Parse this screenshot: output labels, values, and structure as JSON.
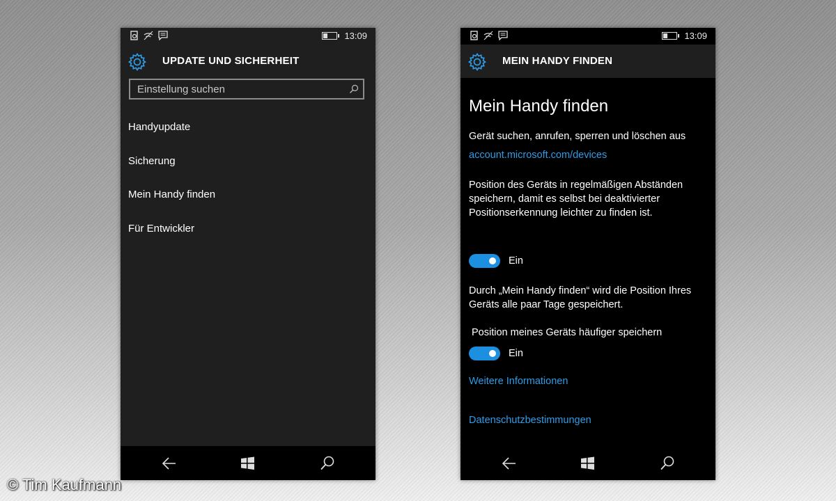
{
  "left_screen": {
    "status_time": "13:09",
    "header_title": "UPDATE UND SICHERHEIT",
    "search_placeholder": "Einstellung suchen",
    "menu_items": [
      "Handyupdate",
      "Sicherung",
      "Mein Handy finden",
      "Für Entwickler"
    ]
  },
  "right_screen": {
    "status_time": "13:09",
    "header_title": "MEIN HANDY FINDEN",
    "page_title": "Mein Handy finden",
    "description_1": "Gerät suchen, anrufen, sperren und löschen aus",
    "link_devices": "account.microsoft.com/devices",
    "description_2": "Position des Geräts in regelmäßigen Abständen speichern, damit es selbst bei deaktivierter Positionserkennung leichter zu finden ist.",
    "toggle_1_label": "Ein",
    "toggle_1_on": true,
    "description_3": "Durch „Mein Handy finden“ wird die Position Ihres Geräts alle paar Tage gespeichert.",
    "option_label": "Position meines Geräts häufiger speichern",
    "toggle_2_label": "Ein",
    "toggle_2_on": true,
    "link_more": "Weitere Informationen",
    "link_privacy": "Datenschutzbestimmungen"
  },
  "icons": [
    "battery-saver-icon",
    "wifi-icon",
    "message-icon",
    "battery-icon",
    "gear-icon",
    "search-icon",
    "back-icon",
    "windows-icon"
  ],
  "colors": {
    "accent": "#1d8fe0",
    "link": "#2f9ce6",
    "panel": "#1f1f1f"
  },
  "watermark": "© Tim Kaufmann"
}
